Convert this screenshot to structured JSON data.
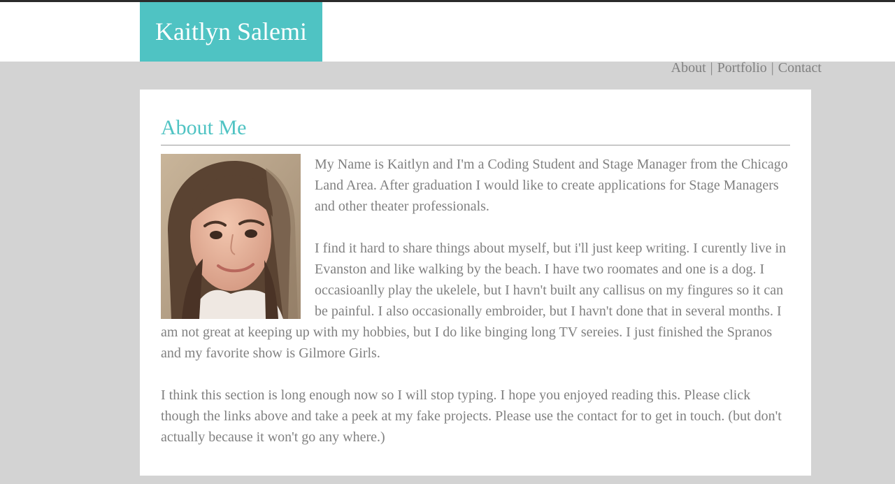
{
  "site": {
    "name": "Kaitlyn Salemi"
  },
  "nav": {
    "items": [
      {
        "label": "About"
      },
      {
        "label": "Portfolio"
      },
      {
        "label": "Contact"
      }
    ],
    "separator": "|"
  },
  "about": {
    "title": "About Me",
    "photo_alt": "portrait photo",
    "paragraphs": [
      "My Name is Kaitlyn and I'm a Coding Student and Stage Manager from the Chicago Land Area. After graduation I would like to create applications for Stage Managers and other theater professionals.",
      "I find it hard to share things about myself, but i'll just keep writing. I curently live in Evanston and like walking by the beach. I have two roomates and one is a dog. I occasioanlly play the ukelele, but I havn't built any callisus on my fingures so it can be painful. I also occasionally embroider, but I havn't done that in several months. I am not great at keeping up with my hobbies, but I do like binging long TV sereies. I just finished the Spranos and my favorite show is Gilmore Girls.",
      "I think this section is long enough now so I will stop typing. I hope you enjoyed reading this. Please click though the links above and take a peek at my fake projects. Please use the contact for to get in touch. (but don't actually because it won't go any where.)"
    ]
  },
  "colors": {
    "accent": "#4fc3c3",
    "background": "#d3d3d3",
    "text": "#808080",
    "topline": "#2b2b2b"
  }
}
